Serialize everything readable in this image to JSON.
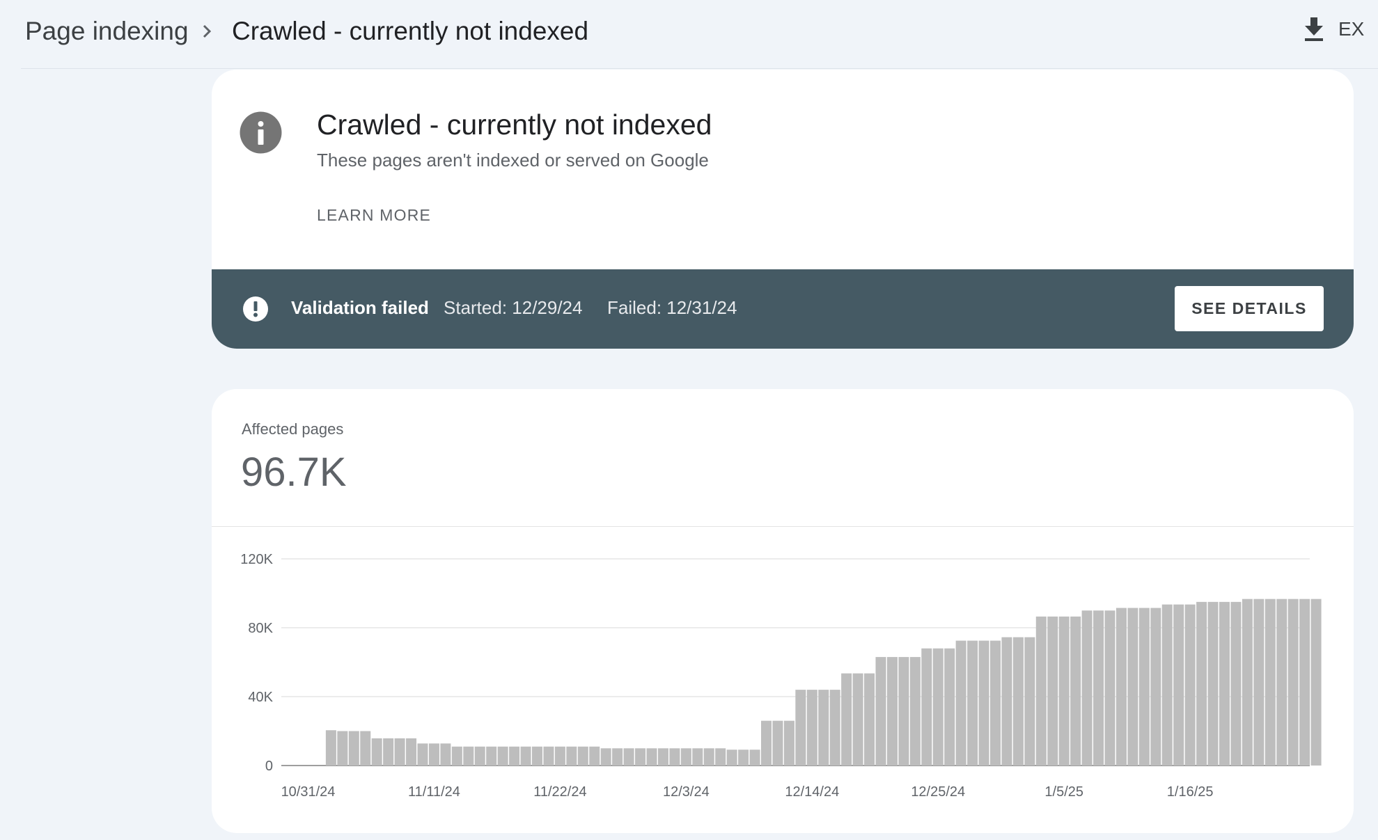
{
  "breadcrumb": {
    "parent": "Page indexing",
    "current": "Crawled - currently not indexed",
    "separator_icon": "chevron-right-icon"
  },
  "toolbar": {
    "export_label": "EX",
    "export_icon": "download-icon"
  },
  "issue": {
    "icon": "info-icon",
    "title": "Crawled - currently not indexed",
    "description": "These pages aren't indexed or served on Google",
    "learn_more": "LEARN MORE"
  },
  "validation": {
    "icon": "alert-icon",
    "status": "Validation failed",
    "started": "Started: 12/29/24",
    "failed": "Failed: 12/31/24",
    "button": "SEE DETAILS",
    "banner_color": "#455a64"
  },
  "affected": {
    "label": "Affected pages",
    "value": "96.7K"
  },
  "chart_data": {
    "type": "bar",
    "ylim": [
      0,
      120000
    ],
    "y_ticks": [
      {
        "value": 0,
        "label": "0"
      },
      {
        "value": 40000,
        "label": "40K"
      },
      {
        "value": 80000,
        "label": "80K"
      },
      {
        "value": 120000,
        "label": "120K"
      }
    ],
    "x_tick_labels": [
      {
        "day": 0,
        "label": "10/31/24"
      },
      {
        "day": 11,
        "label": "11/11/24"
      },
      {
        "day": 22,
        "label": "11/22/24"
      },
      {
        "day": 33,
        "label": "12/3/24"
      },
      {
        "day": 44,
        "label": "12/14/24"
      },
      {
        "day": 55,
        "label": "12/25/24"
      },
      {
        "day": 66,
        "label": "1/5/25"
      },
      {
        "day": 77,
        "label": "1/16/25"
      }
    ],
    "first_bar_day": 2,
    "values": [
      20500,
      20000,
      20000,
      20000,
      15800,
      15800,
      15800,
      15800,
      12800,
      12800,
      12800,
      11000,
      11000,
      11000,
      11000,
      11000,
      11000,
      11000,
      11000,
      11000,
      11000,
      11000,
      11000,
      11000,
      10000,
      10000,
      10000,
      10000,
      10000,
      10000,
      10000,
      10000,
      10000,
      10000,
      10000,
      9200,
      9200,
      9200,
      26000,
      26000,
      26000,
      44000,
      44000,
      44000,
      44000,
      53500,
      53500,
      53500,
      63000,
      63000,
      63000,
      63000,
      68000,
      68000,
      68000,
      72500,
      72500,
      72500,
      72500,
      74500,
      74500,
      74500,
      86500,
      86500,
      86500,
      86500,
      90000,
      90000,
      90000,
      91500,
      91500,
      91500,
      91500,
      93500,
      93500,
      93500,
      95000,
      95000,
      95000,
      95000,
      96700,
      96700,
      96700,
      96700,
      96700,
      96700,
      96700
    ],
    "bar_color": "#bdbdbd",
    "grid": true
  }
}
